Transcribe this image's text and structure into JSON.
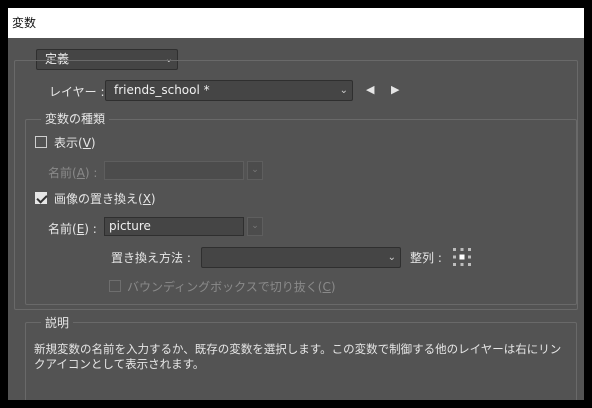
{
  "window": {
    "title": "変数"
  },
  "mode_dropdown": {
    "value": "定義"
  },
  "layer": {
    "label": "レイヤー :",
    "value": "friends_school *",
    "prev_icon": "triangle-left",
    "next_icon": "triangle-right"
  },
  "variable_types": {
    "legend": "変数の種類",
    "visibility": {
      "label": "表示(V)",
      "checked": false
    },
    "visibility_name": {
      "label": "名前(A) :",
      "value": ""
    },
    "pixel_replace": {
      "label": "画像の置き換え(X)",
      "checked": true
    },
    "pixel_name": {
      "label": "名前(E) :",
      "value": "picture"
    },
    "method": {
      "label": "置き換え方法 :",
      "value": ""
    },
    "alignment": {
      "label": "整列 :"
    },
    "clip": {
      "label": "バウンディングボックスで切り抜く(C)",
      "checked": false
    }
  },
  "description": {
    "legend": "説明",
    "text": "新規変数の名前を入力するか、既存の変数を選択します。この変数で制御する他のレイヤーは右にリンクアイコンとして表示されます。"
  }
}
